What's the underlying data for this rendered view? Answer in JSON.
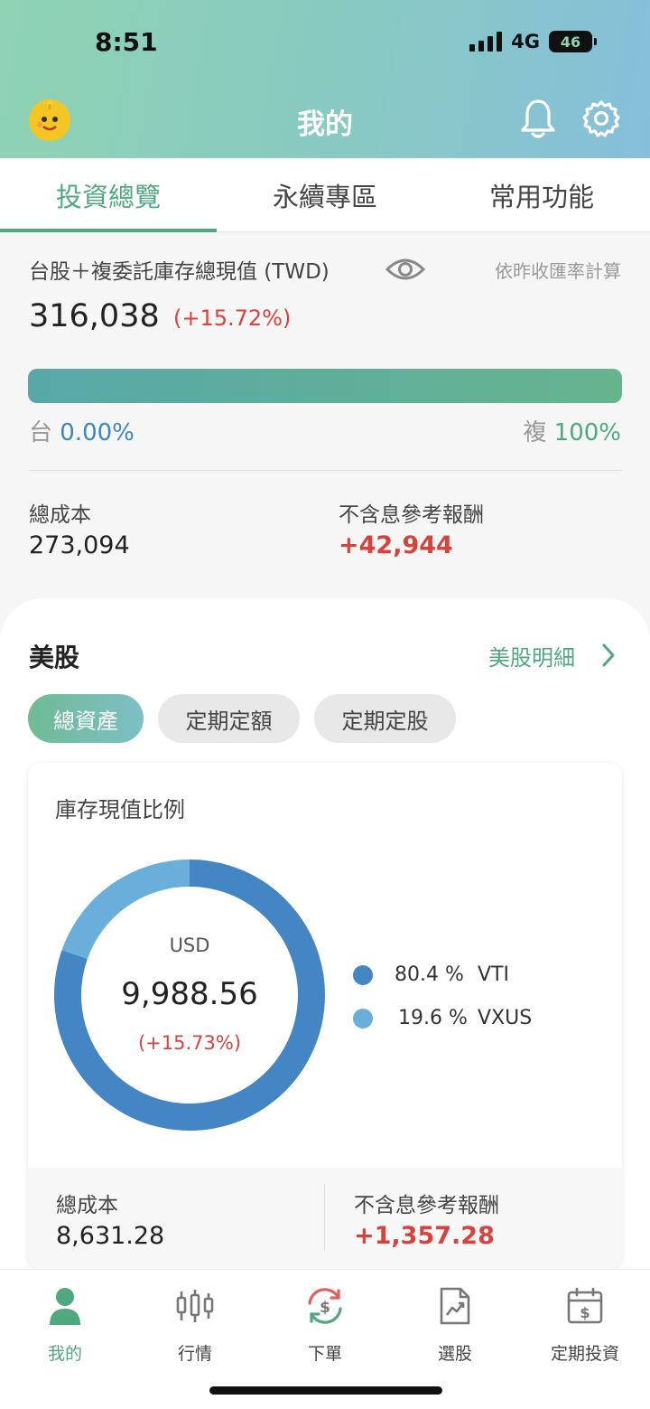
{
  "status_bar": {
    "time": "8:51",
    "network": "4G",
    "battery": "46"
  },
  "header": {
    "title": "我的"
  },
  "tabs": [
    {
      "label": "投資總覽",
      "active": true
    },
    {
      "label": "永續專區",
      "active": false
    },
    {
      "label": "常用功能",
      "active": false
    }
  ],
  "summary": {
    "label": "台股＋複委託庫存總現值 (TWD)",
    "rate_note": "依昨收匯率計算",
    "value": "316,038",
    "change_pct": "(+15.72%)",
    "allocation": {
      "left_label": "台",
      "left_pct": "0.00%",
      "left_value": 0.0,
      "right_label": "複",
      "right_pct": "100%",
      "right_value": 1.0
    },
    "total_cost_label": "總成本",
    "total_cost": "273,094",
    "return_label": "不含息參考報酬",
    "return_value": "+42,944"
  },
  "us_section": {
    "title": "美股",
    "detail_link": "美股明細",
    "chips": [
      {
        "label": "總資產",
        "active": true
      },
      {
        "label": "定期定額",
        "active": false
      },
      {
        "label": "定期定股",
        "active": false
      }
    ],
    "card": {
      "title": "庫存現值比例",
      "currency": "USD",
      "value": "9,988.56",
      "change_pct": "(+15.73%)",
      "total_cost_label": "總成本",
      "total_cost": "8,631.28",
      "return_label": "不含息參考報酬",
      "return_value": "+1,357.28"
    }
  },
  "chart_data": {
    "type": "pie",
    "categories": [
      "VTI",
      "VXUS"
    ],
    "values": [
      80.4,
      19.6
    ],
    "labels": [
      "80.4 %",
      "19.6 %"
    ],
    "colors": [
      "#4485c3",
      "#6aafdb"
    ]
  },
  "bottom_nav": [
    {
      "label": "我的",
      "icon": "person-icon",
      "active": true
    },
    {
      "label": "行情",
      "icon": "candlestick-icon",
      "active": false
    },
    {
      "label": "下單",
      "icon": "order-dollar-icon",
      "active": false
    },
    {
      "label": "選股",
      "icon": "stock-pick-icon",
      "active": false
    },
    {
      "label": "定期投資",
      "icon": "calendar-dollar-icon",
      "active": false
    }
  ]
}
